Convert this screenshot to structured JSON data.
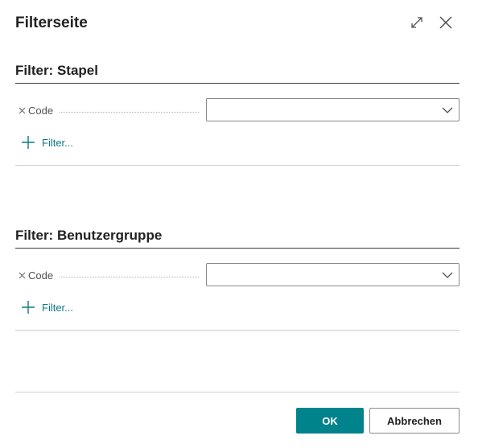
{
  "dialog": {
    "title": "Filterseite",
    "expand_icon": "expand-icon",
    "close_icon": "close-icon"
  },
  "sections": [
    {
      "title": "Filter: Stapel",
      "field_label": "Code",
      "field_value": "",
      "add_filter_label": "Filter..."
    },
    {
      "title": "Filter: Benutzergruppe",
      "field_label": "Code",
      "field_value": "",
      "add_filter_label": "Filter..."
    }
  ],
  "footer": {
    "ok_label": "OK",
    "cancel_label": "Abbrechen"
  },
  "colors": {
    "accent": "#00838a",
    "link": "#0e7a82"
  }
}
